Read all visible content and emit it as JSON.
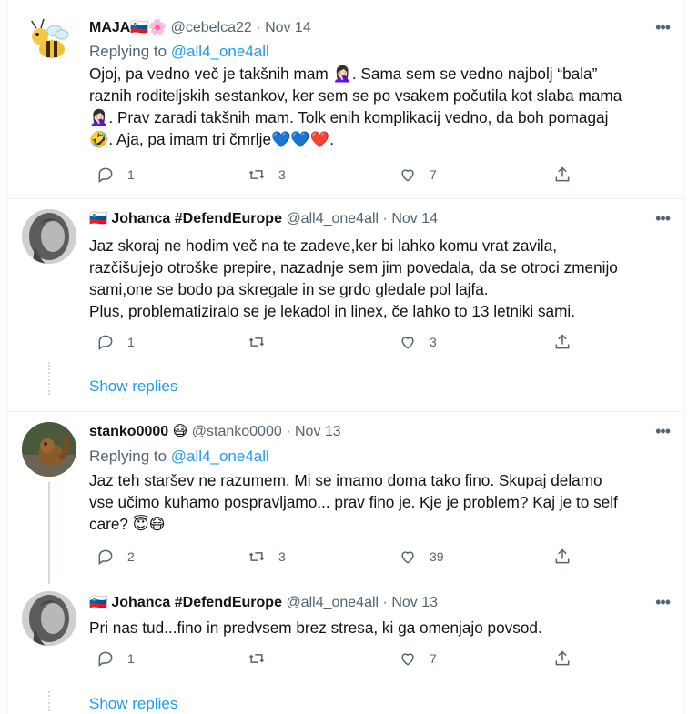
{
  "tweets": [
    {
      "name": "MAJA",
      "flag": "🇸🇮",
      "name_emoji": "🌸",
      "handle": "@cebelca22",
      "dot": "·",
      "date": "Nov 14",
      "more": "•••",
      "replying_prefix": "Replying to",
      "replying_to": "@all4_one4all",
      "text": [
        "Ojoj, pa vedno več je takšnih mam 🤦🏻‍♀️. Sama sem se vedno najbolj “bala”",
        "raznih roditeljskih sestankov, ker sem se po vsakem počutila kot slaba mama",
        "🤦🏻‍♀️. Prav zaradi takšnih mam. Tolk enih komplikacij vedno, da boh pomagaj",
        "🤣. Aja, pa imam tri čmrlje💙💙❤️."
      ],
      "replies": "1",
      "retweets": "3",
      "likes": "7",
      "avatar_icon": "bee-avatar-icon"
    },
    {
      "name": "Johanca #DefendEurope",
      "flag": "🇸🇮",
      "handle": "@all4_one4all",
      "dot": "·",
      "date": "Nov 14",
      "more": "•••",
      "text": [
        "Jaz skoraj ne hodim več na te zadeve,ker bi lahko komu vrat zavila,",
        "razčišujejo otroške prepire, nazadnje sem jim povedala, da se otroci zmenijo",
        "sami,one se bodo pa skregale in se grdo gledale pol lajfa.",
        "Plus, problematiziralo se je lekadol in linex, če lahko to 13 letniki sami."
      ],
      "replies": "1",
      "retweets": "",
      "likes": "3",
      "show_replies": "Show replies",
      "avatar_icon": "woman-bw-avatar-icon"
    },
    {
      "name": "stanko0000",
      "name_emoji": "😷",
      "handle": "@stanko0000",
      "dot": "·",
      "date": "Nov 13",
      "more": "•••",
      "replying_prefix": "Replying to",
      "replying_to": "@all4_one4all",
      "text": [
        "Jaz teh staršev ne razumem. Mi se imamo doma tako fino. Skupaj delamo",
        "vse učimo kuhamo pospravljamo... prav fino je. Kje je problem? Kaj je to self",
        "care? 😇😷"
      ],
      "replies": "2",
      "retweets": "3",
      "likes": "39",
      "avatar_icon": "squirrel-avatar-icon"
    },
    {
      "name": "Johanca #DefendEurope",
      "flag": "🇸🇮",
      "handle": "@all4_one4all",
      "dot": "·",
      "date": "Nov 13",
      "more": "•••",
      "text": [
        "Pri nas tud...fino in predvsem brez stresa, ki ga omenjajo povsod."
      ],
      "replies": "1",
      "retweets": "",
      "likes": "7",
      "show_replies": "Show replies",
      "avatar_icon": "woman-bw-avatar-icon"
    }
  ],
  "colors": {
    "accent": "#1d9bf0",
    "muted": "#536471",
    "text": "#0f1419",
    "border": "#eff3f4"
  }
}
